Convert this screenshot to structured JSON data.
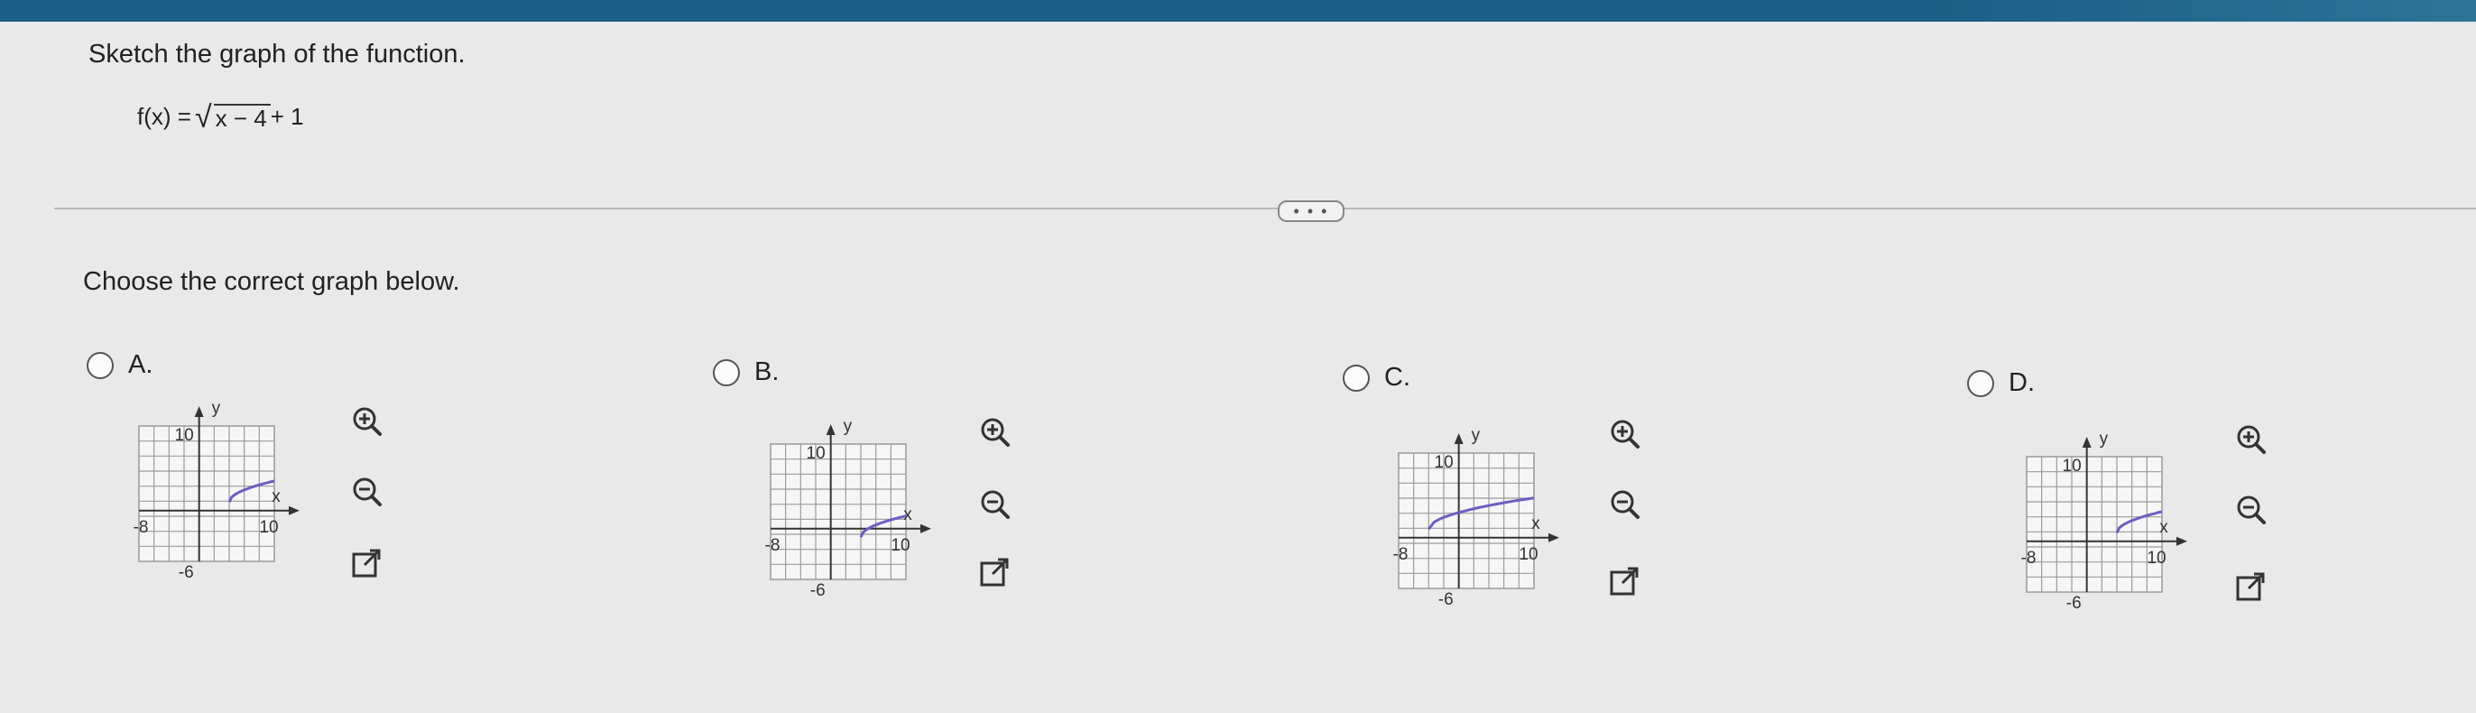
{
  "question": {
    "title": "Sketch the graph of the function.",
    "function_lhs": "f(x) = ",
    "function_radicand": "x − 4",
    "function_tail": " + 1",
    "radical_symbol": "√",
    "more_button_label": "• • •",
    "prompt": "Choose the correct graph below."
  },
  "options": [
    {
      "letter": "A.",
      "graph": {
        "y_label": "y",
        "x_label": "x",
        "y_top_tick": "10",
        "x_left_tick": "-8",
        "x_right_tick": "10",
        "y_bottom_tick": "-6",
        "curve_start": [
          4,
          1
        ],
        "curve_end": [
          10,
          3.5
        ]
      }
    },
    {
      "letter": "B.",
      "graph": {
        "y_label": "y",
        "x_label": "x",
        "y_top_tick": "10",
        "x_left_tick": "-8",
        "x_right_tick": "10",
        "y_bottom_tick": "-6",
        "curve_start": [
          4,
          -1
        ],
        "curve_end": [
          10,
          1.5
        ]
      }
    },
    {
      "letter": "C.",
      "graph": {
        "y_label": "y",
        "x_label": "x",
        "y_top_tick": "10",
        "x_left_tick": "-8",
        "x_right_tick": "10",
        "y_bottom_tick": "-6",
        "curve_start": [
          -4,
          1
        ],
        "curve_end": [
          10,
          4.7
        ]
      }
    },
    {
      "letter": "D.",
      "graph": {
        "y_label": "y",
        "x_label": "x",
        "y_top_tick": "10",
        "x_left_tick": "-8",
        "x_right_tick": "10",
        "y_bottom_tick": "-6",
        "curve_start": [
          4,
          1
        ],
        "curve_end": [
          10,
          3.5
        ]
      }
    }
  ],
  "icons": {
    "zoom_in": "zoom-in-icon",
    "zoom_out": "zoom-out-icon",
    "open_new": "open-new-window-icon"
  },
  "colors": {
    "header_bar": "#1b5f86",
    "curve": "#6a5fc1",
    "grid": "#9a9a9a",
    "axis": "#333333"
  }
}
